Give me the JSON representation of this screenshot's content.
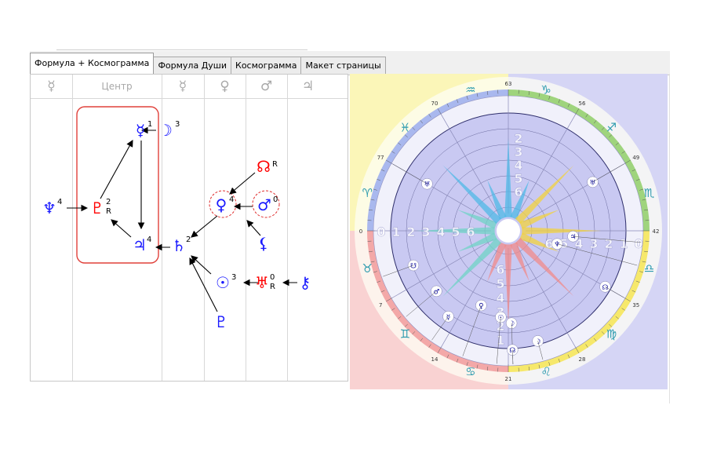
{
  "tabs": [
    {
      "label": "Формула + Космограмма",
      "active": true
    },
    {
      "label": "Формула Души",
      "active": false
    },
    {
      "label": "Космограмма",
      "active": false
    },
    {
      "label": "Макет страницы",
      "active": false
    }
  ],
  "formula": {
    "columns": [
      {
        "label": "☿",
        "kind": "symbol"
      },
      {
        "label": "Центр",
        "kind": "text"
      },
      {
        "label": "☿",
        "kind": "symbol"
      },
      {
        "label": "♀",
        "kind": "symbol"
      },
      {
        "label": "♂",
        "kind": "symbol"
      },
      {
        "label": "♃",
        "kind": "symbol"
      }
    ],
    "nodes": {
      "mercury": {
        "glyph": "☿",
        "num": "1",
        "color": "#1a1aff"
      },
      "moon": {
        "glyph": "☽",
        "num": "3",
        "color": "#1a1aff"
      },
      "pluto": {
        "glyph": "♇",
        "num": "2",
        "sub": "R",
        "color": "#ff0000"
      },
      "neptune": {
        "glyph": "♆",
        "num": "4",
        "color": "#1a1aff"
      },
      "jupiter": {
        "glyph": "♃",
        "num": "4",
        "color": "#1a1aff"
      },
      "saturn": {
        "glyph": "♄",
        "num": "2",
        "color": "#1a1aff"
      },
      "venus": {
        "glyph": "♀",
        "num": "4",
        "color": "#1a1aff"
      },
      "mars": {
        "glyph": "♂",
        "num": "0",
        "color": "#1a1aff"
      },
      "node": {
        "glyph": "☊",
        "num": "R",
        "color": "#ff0000"
      },
      "lilith": {
        "glyph": "⚸",
        "num": "",
        "color": "#1a1aff"
      },
      "sun": {
        "glyph": "☉",
        "num": "3",
        "color": "#1a1aff"
      },
      "uranus": {
        "glyph": "♅",
        "num": "0",
        "sub": "R",
        "color": "#ff0000"
      },
      "chiron": {
        "glyph": "⚷",
        "num": "",
        "color": "#1a1aff"
      },
      "proserpina": {
        "glyph": "♇",
        "num": "",
        "color": "#1a1aff"
      }
    }
  },
  "cosmogram": {
    "degree_labels": [
      "63",
      "56",
      "49",
      "42",
      "35",
      "28",
      "21",
      "14",
      "7",
      "0",
      "77",
      "70"
    ],
    "signs": [
      "♑",
      "♐",
      "♏",
      "♎",
      "♍",
      "♌",
      "♋",
      "♊",
      "♉",
      "♈",
      "♓",
      "♒"
    ],
    "ring_numbers_left": [
      "0",
      "1",
      "2",
      "3",
      "4",
      "5",
      "6"
    ],
    "ring_numbers_right": [
      "6",
      "5",
      "4",
      "3",
      "2",
      "1",
      "0"
    ],
    "ring_numbers_top": [
      "2",
      "3",
      "4",
      "5",
      "6"
    ],
    "ring_numbers_bottom": [
      "6",
      "5",
      "4",
      "3",
      "2",
      "1"
    ],
    "planets": [
      "♀",
      "☉",
      "☽",
      "♃",
      "♆",
      "☋",
      "♅",
      "☊",
      "☊",
      "♂",
      "☿",
      "☽",
      "♅"
    ],
    "colors": {
      "inner": "#c9c9f2",
      "quadrant_yellow": "#fbf6b8",
      "quadrant_blue": "#d5d5f5",
      "quadrant_pink": "#f9d2d2",
      "sign_color": "#2a9aae"
    }
  }
}
